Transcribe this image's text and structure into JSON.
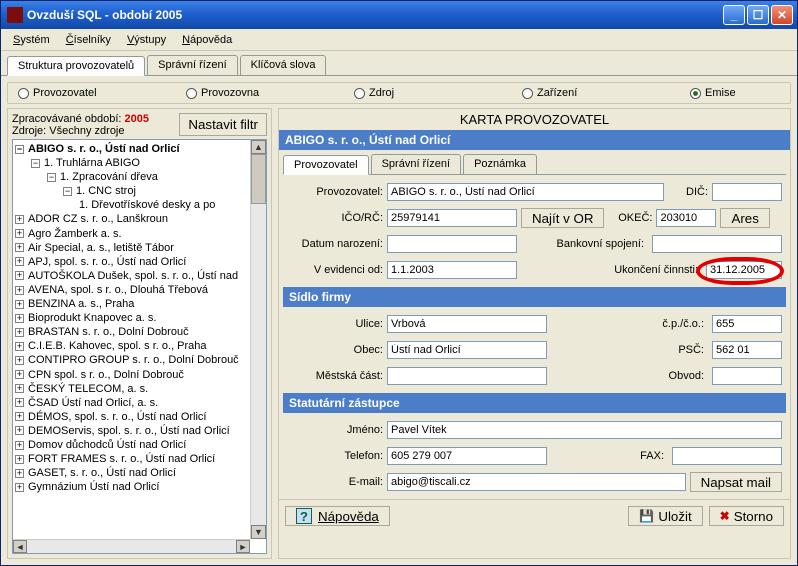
{
  "window": {
    "title": "Ovzduší SQL  - období 2005"
  },
  "menu": {
    "system": "Systém",
    "ciselniky": "Číselníky",
    "vystupy": "Výstupy",
    "napoveda": "Nápověda"
  },
  "mainTabs": {
    "struktura": "Struktura provozovatelů",
    "spravni": "Správní řízení",
    "klicova": "Klíčová slova"
  },
  "radios": {
    "provozovatel": "Provozovatel",
    "provozovna": "Provozovna",
    "zdroj": "Zdroj",
    "zarizeni": "Zařízení",
    "emise": "Emise"
  },
  "leftPane": {
    "periodLabel": "Zpracovávané období:",
    "periodValue": "2005",
    "sourceLabel": "Zdroje: Všechny zdroje",
    "filterBtn": "Nastavit filtr",
    "tree": {
      "root": "ABIGO s. r. o., Ústí nad Orlicí",
      "n1": "1. Truhlárna ABIGO",
      "n2": "1. Zpracování dřeva",
      "n3": "1. CNC stroj",
      "n4": "1. Dřevotřískové desky a po",
      "items": [
        "ADOR CZ s. r. o., Lanškroun",
        "Agro Žamberk a. s.",
        "Air Special, a. s., letiště Tábor",
        "APJ, spol. s. r. o., Ústí nad Orlicí",
        "AUTOŠKOLA Dušek, spol. s. r. o., Ústí nad",
        "AVENA, spol. s r. o., Dlouhá Třebová",
        "BENZINA a. s., Praha",
        "Bioprodukt Knapovec a. s.",
        "BRASTAN s. r. o., Dolní Dobrouč",
        "C.I.E.B. Kahovec, spol. s r. o., Praha",
        "CONTIPRO GROUP s. r. o., Dolní Dobrouč",
        "CPN spol. s r. o., Dolní Dobrouč",
        "ČESKÝ TELECOM, a. s.",
        "ČSAD Ústí nad Orlicí, a. s.",
        "DÉMOS, spol. s. r. o., Ústí nad Orlicí",
        "DEMOServis, spol. s. r. o., Ústí nad Orlicí",
        "Domov důchodců Ústí nad Orlicí",
        "FORT FRAMES s. r. o., Ústí nad Orlicí",
        "GASET, s. r. o., Ústí nad Orlicí",
        "Gymnázium Ústí nad Orlicí"
      ]
    }
  },
  "card": {
    "title": "KARTA PROVOZOVATEL",
    "header": "ABIGO s. r. o., Ústí nad Orlicí",
    "subtabs": {
      "provozovatel": "Provozovatel",
      "spravni": "Správní řízení",
      "poznamka": "Poznámka"
    },
    "labels": {
      "provozovatel": "Provozovatel:",
      "icorc": "IČO/RČ:",
      "narozeni": "Datum narození:",
      "evidenceOd": "V evidenci od:",
      "dic": "DIČ:",
      "okec": "OKEČ:",
      "bankovni": "Bankovní spojení:",
      "ukonceni": "Ukončení činnsti:",
      "najitOR": "Najít v OR",
      "ares": "Ares"
    },
    "values": {
      "provozovatel": "ABIGO s. r. o., Ústí nad Orlicí",
      "icorc": "25979141",
      "narozeni": "",
      "evidenceOd": "1.1.2003",
      "dic": "",
      "okec": "203010",
      "bankovni": "",
      "ukonceni": "31.12.2005"
    },
    "sidlo": {
      "title": "Sídlo firmy",
      "labels": {
        "ulice": "Ulice:",
        "obec": "Obec:",
        "mestska": "Městská část:",
        "cpco": "č.p./č.o.:",
        "psc": "PSČ:",
        "obvod": "Obvod:"
      },
      "values": {
        "ulice": "Vrbová",
        "obec": "Ústí nad Orlicí",
        "mestska": "",
        "cpco": "655",
        "psc": "562 01",
        "obvod": ""
      }
    },
    "statutarni": {
      "title": "Statutární zástupce",
      "labels": {
        "jmeno": "Jméno:",
        "telefon": "Telefon:",
        "fax": "FAX:",
        "email": "E-mail:",
        "napsat": "Napsat mail"
      },
      "values": {
        "jmeno": "Pavel Vítek",
        "telefon": "605 279 007",
        "fax": "",
        "email": "abigo@tiscali.cz"
      }
    }
  },
  "footer": {
    "napoveda": "Nápověda",
    "ulozit": "Uložit",
    "storno": "Storno"
  }
}
